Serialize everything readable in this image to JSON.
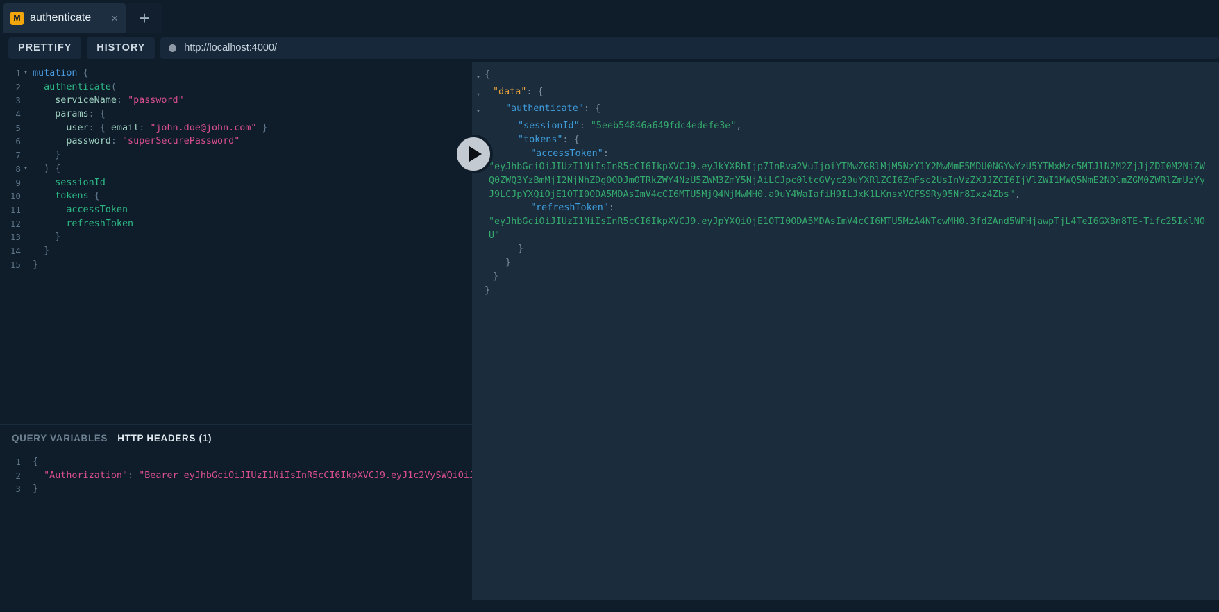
{
  "window": {
    "title": "authenticate"
  },
  "tabs": {
    "items": [
      {
        "badge": "M",
        "title": "authenticate",
        "close": "×"
      }
    ],
    "add_label": "+"
  },
  "toolbar": {
    "prettify_label": "PRETTIFY",
    "history_label": "HISTORY",
    "url": "http://localhost:4000/",
    "url_icon": "radio-dot-icon"
  },
  "run_button": {
    "icon": "play-icon"
  },
  "query_editor": {
    "lines": [
      {
        "num": "1",
        "fold": "▾",
        "segments": [
          {
            "c": "t-kw",
            "t": "mutation"
          },
          {
            "c": "t-punc",
            "t": " {"
          }
        ]
      },
      {
        "num": "2",
        "fold": "",
        "segments": [
          {
            "c": "t-fld",
            "t": "  authenticate"
          },
          {
            "c": "t-punc",
            "t": "("
          }
        ]
      },
      {
        "num": "3",
        "fold": "",
        "segments": [
          {
            "c": "t-arg",
            "t": "    serviceName"
          },
          {
            "c": "t-punc",
            "t": ": "
          },
          {
            "c": "t-str",
            "t": "\"password\""
          }
        ]
      },
      {
        "num": "4",
        "fold": "",
        "segments": [
          {
            "c": "t-arg",
            "t": "    params"
          },
          {
            "c": "t-punc",
            "t": ": {"
          }
        ]
      },
      {
        "num": "5",
        "fold": "",
        "segments": [
          {
            "c": "t-arg",
            "t": "      user"
          },
          {
            "c": "t-punc",
            "t": ": { "
          },
          {
            "c": "t-arg",
            "t": "email"
          },
          {
            "c": "t-punc",
            "t": ": "
          },
          {
            "c": "t-str",
            "t": "\"john.doe@john.com\""
          },
          {
            "c": "t-punc",
            "t": " }"
          }
        ]
      },
      {
        "num": "6",
        "fold": "",
        "segments": [
          {
            "c": "t-arg",
            "t": "      password"
          },
          {
            "c": "t-punc",
            "t": ": "
          },
          {
            "c": "t-str",
            "t": "\"superSecurePassword\""
          }
        ]
      },
      {
        "num": "7",
        "fold": "",
        "segments": [
          {
            "c": "t-punc",
            "t": "    }"
          }
        ]
      },
      {
        "num": "8",
        "fold": "▾",
        "segments": [
          {
            "c": "t-punc",
            "t": "  ) {"
          }
        ]
      },
      {
        "num": "9",
        "fold": "",
        "segments": [
          {
            "c": "t-fld",
            "t": "    sessionId"
          }
        ]
      },
      {
        "num": "10",
        "fold": "",
        "segments": [
          {
            "c": "t-fld",
            "t": "    tokens"
          },
          {
            "c": "t-punc",
            "t": " {"
          }
        ]
      },
      {
        "num": "11",
        "fold": "",
        "segments": [
          {
            "c": "t-fld",
            "t": "      accessToken"
          }
        ]
      },
      {
        "num": "12",
        "fold": "",
        "segments": [
          {
            "c": "t-fld",
            "t": "      refreshToken"
          }
        ]
      },
      {
        "num": "13",
        "fold": "",
        "segments": [
          {
            "c": "t-punc",
            "t": "    }"
          }
        ]
      },
      {
        "num": "14",
        "fold": "",
        "segments": [
          {
            "c": "t-punc",
            "t": "  }"
          }
        ]
      },
      {
        "num": "15",
        "fold": "",
        "segments": [
          {
            "c": "t-punc",
            "t": "}"
          }
        ]
      }
    ]
  },
  "variables_panel": {
    "tab_query_variables": "QUERY VARIABLES",
    "tab_http_headers": "HTTP HEADERS (1)",
    "active_tab": "HTTP HEADERS (1)",
    "lines": [
      {
        "num": "1",
        "segments": [
          {
            "c": "j-punc",
            "t": "{"
          }
        ]
      },
      {
        "num": "2",
        "segments": [
          {
            "c": "j-key",
            "t": "  \"Authorization\""
          },
          {
            "c": "j-punc",
            "t": ": "
          },
          {
            "c": "j-str",
            "t": "\"Bearer eyJhbGciOiJIUzI1NiIsInR5cCI6IkpXVCJ9.eyJ1c2VySWQiOiJj"
          }
        ]
      },
      {
        "num": "3",
        "segments": [
          {
            "c": "j-punc",
            "t": "}"
          }
        ]
      }
    ]
  },
  "response": {
    "lines": [
      {
        "fold": "▾",
        "indent": 0,
        "segments": [
          {
            "c": "r-punc",
            "t": "{"
          }
        ]
      },
      {
        "fold": "▾",
        "indent": 12,
        "segments": [
          {
            "c": "rk-data",
            "t": "\"data\""
          },
          {
            "c": "r-punc",
            "t": ": {"
          }
        ]
      },
      {
        "fold": "▾",
        "indent": 30,
        "segments": [
          {
            "c": "rk-key",
            "t": "\"authenticate\""
          },
          {
            "c": "r-punc",
            "t": ": {"
          }
        ]
      },
      {
        "fold": "",
        "indent": 48,
        "segments": [
          {
            "c": "rk-key",
            "t": "\"sessionId\""
          },
          {
            "c": "r-punc",
            "t": ": "
          },
          {
            "c": "rv-str",
            "t": "\"5eeb54846a649fdc4edefe3e\""
          },
          {
            "c": "r-punc",
            "t": ","
          }
        ]
      },
      {
        "fold": "",
        "indent": 48,
        "segments": [
          {
            "c": "rk-key",
            "t": "\"tokens\""
          },
          {
            "c": "r-punc",
            "t": ": {"
          }
        ]
      },
      {
        "fold": "",
        "indent": 66,
        "segments": [
          {
            "c": "rk-key",
            "t": "\"accessToken\""
          },
          {
            "c": "r-punc",
            "t": ":"
          }
        ]
      },
      {
        "fold": "",
        "indent": 6,
        "segments": [
          {
            "c": "rv-str",
            "t": "\"eyJhbGciOiJIUzI1NiIsInR5cCI6IkpXVCJ9.eyJkYXRhIjp7InRva2VuIjoiYTMwZGRlMjM5NzY1Y2MwMmE5MDU0NGYwYzU5YTMxMzc5MTJlN2M2ZjJjZDI0M2NiZWQ0ZWQ3YzBmMjI2NjNhZDg0ODJmOTRkZWY4NzU5ZWM3ZmY5NjAiLCJpc0ltcGVyc29uYXRlZCI6ZmFsc2UsInVzZXJJZCI6IjVlZWI1MWQ5NmE2NDlmZGM0ZWRlZmUzYyJ9LCJpYXQiOjE1OTI0ODA5MDAsImV4cCI6MTU5MjQ4NjMwMH0.a9uY4WaIafiH9ILJxK1LKnsxVCFSSRy95Nr8Ixz4Zbs\""
          },
          {
            "c": "r-punc",
            "t": ","
          }
        ]
      },
      {
        "fold": "",
        "indent": 66,
        "segments": [
          {
            "c": "rk-key",
            "t": "\"refreshToken\""
          },
          {
            "c": "r-punc",
            "t": ":"
          }
        ]
      },
      {
        "fold": "",
        "indent": 6,
        "segments": [
          {
            "c": "rv-str",
            "t": "\"eyJhbGciOiJIUzI1NiIsInR5cCI6IkpXVCJ9.eyJpYXQiOjE1OTI0ODA5MDAsImV4cCI6MTU5MzA4NTcwMH0.3fdZAnd5WPHjawpTjL4TeI6GXBn8TE-Tifc25IxlNOU\""
          }
        ]
      },
      {
        "fold": "",
        "indent": 48,
        "segments": [
          {
            "c": "r-punc",
            "t": "}"
          }
        ]
      },
      {
        "fold": "",
        "indent": 30,
        "segments": [
          {
            "c": "r-punc",
            "t": "}"
          }
        ]
      },
      {
        "fold": "",
        "indent": 12,
        "segments": [
          {
            "c": "r-punc",
            "t": "}"
          }
        ]
      },
      {
        "fold": "",
        "indent": 0,
        "segments": [
          {
            "c": "r-punc",
            "t": "}"
          }
        ]
      }
    ]
  }
}
